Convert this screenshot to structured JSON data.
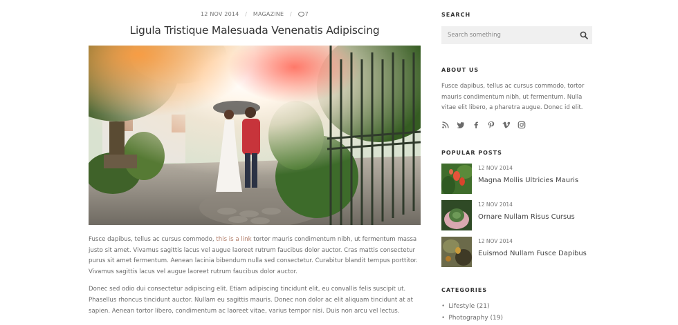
{
  "post": {
    "date": "12 NOV 2014",
    "category": "MAGAZINE",
    "comments": "7",
    "title": "Ligula Tristique Malesuada Venenatis Adipiscing",
    "p1_before_link": "Fusce dapibus, tellus ac cursus commodo, ",
    "p1_link": "this is a link",
    "p1_after_link": " tortor mauris condimentum nibh, ut fermentum massa justo sit amet. Vivamus sagittis lacus vel augue laoreet rutrum faucibus dolor auctor. Cras mattis consectetur purus sit amet fermentum. Aenean lacinia bibendum nulla sed consectetur. Curabitur blandit tempus porttitor. Vivamus sagittis lacus vel augue laoreet rutrum faucibus dolor auctor.",
    "p2": "Donec sed odio dui consectetur adipiscing elit. Etiam adipiscing tincidunt elit, eu convallis felis suscipit ut. Phasellus rhoncus tincidunt auctor. Nullam eu sagittis mauris. Donec non dolor ac elit aliquam tincidunt at at sapien. Aenean tortor libero, condimentum ac laoreet vitae, varius tempor nisi. Duis non arcu vel lectus."
  },
  "sidebar": {
    "search": {
      "title": "SEARCH",
      "placeholder": "Search something",
      "icon": "search-icon"
    },
    "about": {
      "title": "ABOUT US",
      "text": "Fusce dapibus, tellus ac cursus commodo, tortor mauris condimentum nibh, ut fermentum. Nulla vitae elit libero, a pharetra augue. Donec id elit.",
      "socials": [
        "rss-icon",
        "twitter-icon",
        "facebook-icon",
        "pinterest-icon",
        "vimeo-icon",
        "instagram-icon"
      ]
    },
    "popular": {
      "title": "POPULAR POSTS",
      "items": [
        {
          "date": "12 NOV 2014",
          "title": "Magna Mollis Ultricies Mauris"
        },
        {
          "date": "12 NOV 2014",
          "title": "Ornare Nullam Risus Cursus"
        },
        {
          "date": "12 NOV 2014",
          "title": "Euismod Nullam Fusce Dapibus"
        }
      ]
    },
    "categories": {
      "title": "CATEGORIES",
      "items": [
        "Lifestyle (21)",
        "Photography (19)"
      ]
    }
  },
  "colors": {
    "link": "#b07a66",
    "search_bg": "#f0f0f0",
    "text": "#6a6a6a",
    "heading": "#333333"
  }
}
